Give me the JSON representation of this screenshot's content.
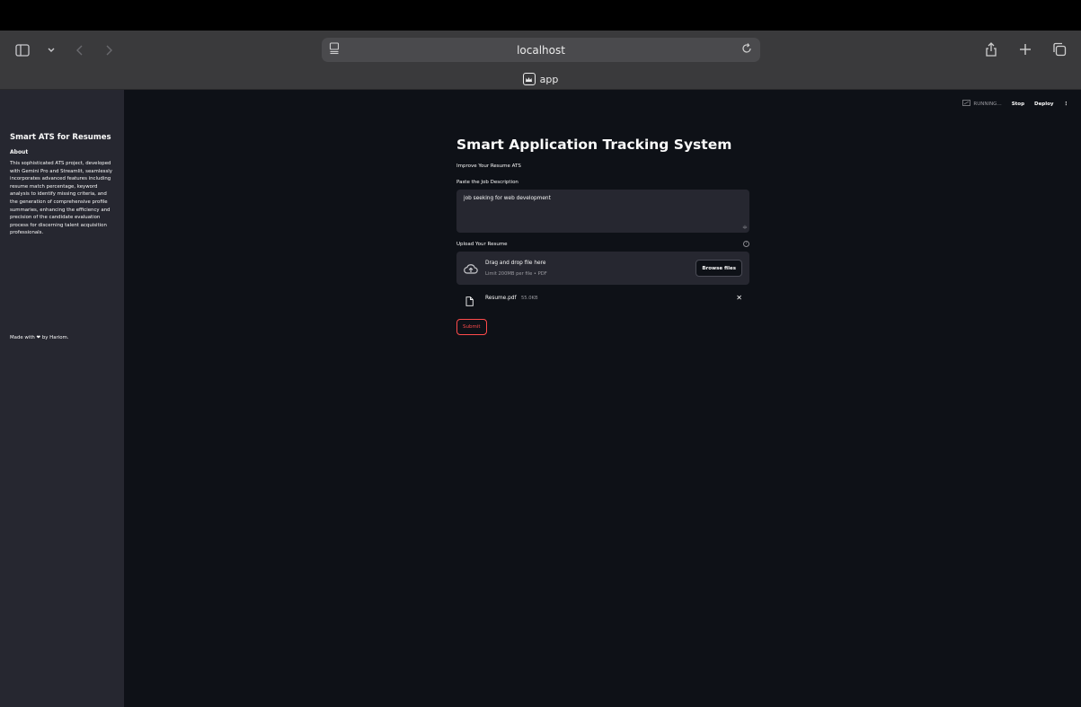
{
  "browser": {
    "url": "localhost",
    "tab_title": "app"
  },
  "sidebar": {
    "title": "Smart ATS for Resumes",
    "about_heading": "About",
    "about_text": "This sophisticated ATS project, developed with Gemini Pro and Streamlit, seamlessly incorporates advanced features including resume match percentage, keyword analysis to identify missing criteria, and the generation of comprehensive profile summaries, enhancing the efficiency and precision of the candidate evaluation process for discerning talent acquisition professionals.",
    "made_with_prefix": "Made with",
    "made_with_suffix": "by Hariom."
  },
  "header": {
    "status": "RUNNING...",
    "stop_label": "Stop",
    "deploy_label": "Deploy",
    "menu_icon": "kebab-icon"
  },
  "main": {
    "title": "Smart Application Tracking System",
    "subheader": "Improve Your Resume ATS",
    "jd_label": "Paste the Job Description",
    "jd_value": "job seeking for web development",
    "upload_label": "Upload Your Resume",
    "dropzone_main": "Drag and drop file here",
    "dropzone_sub": "Limit 200MB per file • PDF",
    "browse_label": "Browse files",
    "file": {
      "name": "Resume.pdf",
      "size": "55.0KB"
    },
    "submit_label": "Submit"
  },
  "colors": {
    "sidebar_bg": "#262730",
    "main_bg": "#0e1117",
    "accent": "#ff4b4b"
  }
}
